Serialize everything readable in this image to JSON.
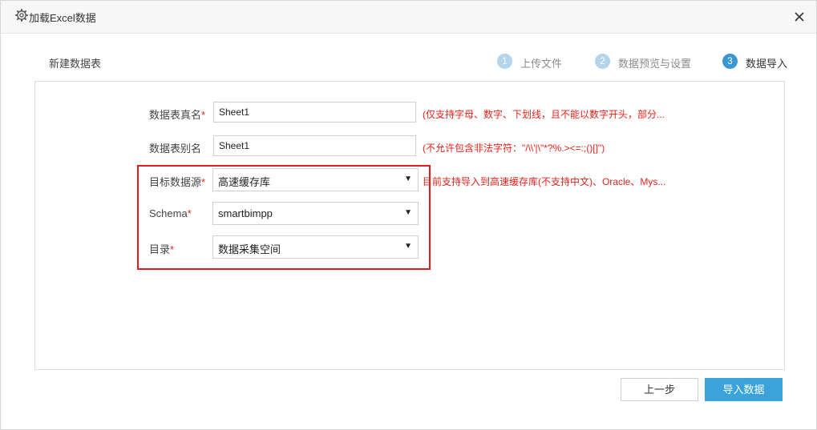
{
  "dialog": {
    "title": "加载Excel数据"
  },
  "section_title": "新建数据表",
  "steps": [
    {
      "num": "1",
      "label": "上传文件",
      "state": "inactive"
    },
    {
      "num": "2",
      "label": "数据预览与设置",
      "state": "inactive"
    },
    {
      "num": "3",
      "label": "数据导入",
      "state": "active"
    }
  ],
  "form": {
    "real_name": {
      "label": "数据表真名",
      "required": "*",
      "value": "Sheet1",
      "hint": "(仅支持字母、数字、下划线，且不能以数字开头，部分..."
    },
    "alias": {
      "label": "数据表别名",
      "value": "Sheet1",
      "hint": "(不允许包含非法字符：\"/\\\\'|\\\"*?%.><=:;()[]\")"
    },
    "datasource": {
      "label": "目标数据源",
      "required": "*",
      "value": "高速缓存库",
      "hint": "目前支持导入到高速缓存库(不支持中文)、Oracle、Mys..."
    },
    "schema": {
      "label": "Schema",
      "required": "*",
      "value": "smartbimpp"
    },
    "directory": {
      "label": "目录",
      "required": "*",
      "value": "数据采集空间"
    }
  },
  "buttons": {
    "prev": "上一步",
    "import": "导入数据"
  },
  "colors": {
    "accent": "#3aa3d9",
    "required": "#e2231a",
    "highlight": "#e41a1a",
    "step_active": "#3a97d6",
    "step_inactive": "#b3d4ea"
  }
}
